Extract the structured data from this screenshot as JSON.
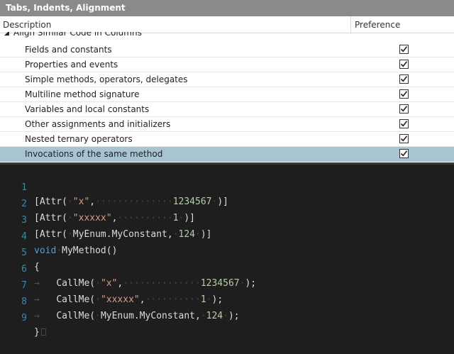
{
  "window": {
    "title": "Tabs, Indents, Alignment"
  },
  "grid": {
    "columns": {
      "description": "Description",
      "preference": "Preference"
    },
    "group_label": "Align Similar Code in Columns",
    "rows": [
      {
        "label": "Fields and constants",
        "checked": true
      },
      {
        "label": "Properties and events",
        "checked": true
      },
      {
        "label": "Simple methods, operators, delegates",
        "checked": true
      },
      {
        "label": "Multiline method signature",
        "checked": true
      },
      {
        "label": "Variables and local constants",
        "checked": true
      },
      {
        "label": "Other assignments and initializers",
        "checked": true
      },
      {
        "label": "Nested ternary operators",
        "checked": true
      },
      {
        "label": "Invocations of the same method",
        "checked": true,
        "selected": true
      }
    ]
  },
  "editor": {
    "line_numbers": [
      "1",
      "2",
      "3",
      "4",
      "5",
      "6",
      "7",
      "8",
      "9"
    ],
    "tokens": {
      "attr_open": "[Attr(",
      "attr_close_bracket": ")]",
      "str_x": "\"x\"",
      "str_xxxxx": "\"xxxxx\"",
      "num_1234567": "1234567",
      "num_1": "1",
      "num_124": "124",
      "enum_const": "MyEnum.MyConstant",
      "comma": ",",
      "close_paren_bracket": ")]",
      "kw_void": "void",
      "method_decl": "MyMethod()",
      "brace_open": "{",
      "brace_close": "}",
      "call_open": "CallMe(",
      "call_close": ");",
      "close_paren_semicolon": ");"
    }
  },
  "colors": {
    "title_bar": "#8a8a8a",
    "selected_row": "#a7c4d3",
    "editor_bg": "#1e1e1e",
    "line_number": "#2b91af",
    "keyword": "#569cd6",
    "string": "#d69d85",
    "number": "#b5cea8"
  }
}
